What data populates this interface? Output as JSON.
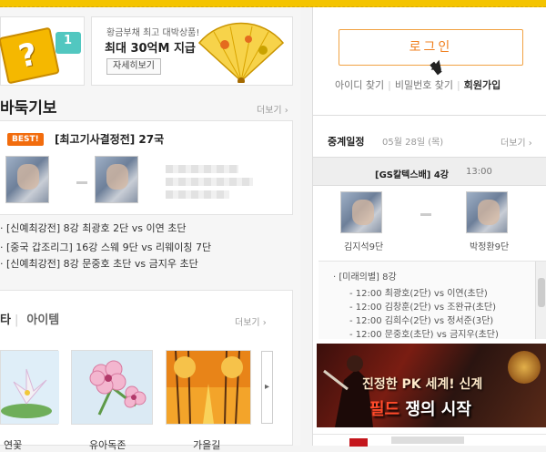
{
  "promo": {
    "icon_question": "?",
    "gift_number": "1",
    "subtitle": "황금부채 최고 대박상품!",
    "title": "최대 30억M 지급",
    "detail_button": "자세히보기"
  },
  "baduk": {
    "title": "바둑기보",
    "more": "더보기 ›",
    "badge": "BEST!",
    "match_title": "[최고기사결정전] 27국",
    "news": [
      "· [신예최강전] 8강 최광호 2단 vs 이연 초단",
      "· [중국 갑조리그] 16강 스웨 9단 vs 리웨이칭 7단",
      "· [신예최강전] 8강 문중호 초단 vs 금지우 초단"
    ]
  },
  "items": {
    "tab_active": "타",
    "tab_other": "아이템",
    "more": "더보기 ›",
    "next_icon": "▸",
    "thumbs": [
      {
        "label": "연꽃"
      },
      {
        "label": "유아독존"
      },
      {
        "label": "가을길"
      }
    ]
  },
  "login": {
    "button": "로그인",
    "find_id": "아이디 찾기",
    "find_pw": "비밀번호 찾기",
    "join": "회원가입"
  },
  "schedule": {
    "title": "중계일정",
    "date": "05월 28일 (목)",
    "more": "더보기 ›",
    "game_title": "[GS칼텍스배] 4강",
    "game_time": "13:00",
    "player_left": "김지석9단",
    "player_right": "박정환9단",
    "list_header": "· [미래의별] 8강",
    "list": [
      "- 12:00 최광호(2단) vs 이연(초단)",
      "- 12:00 김창훈(2단) vs 조완규(초단)",
      "- 12:00 김희수(2단) vs 정서준(3단)",
      "- 12:00 문중호(초단) vs 금지우(초단)"
    ]
  },
  "ad": {
    "line1": "진정한 PK 세계! 신계",
    "line2_highlight": "필드",
    "line2_rest": " 쟁의 시작"
  },
  "colors": {
    "accent_orange": "#f08020",
    "best_badge": "#f26c0d",
    "topbar_yellow": "#f4c400"
  }
}
